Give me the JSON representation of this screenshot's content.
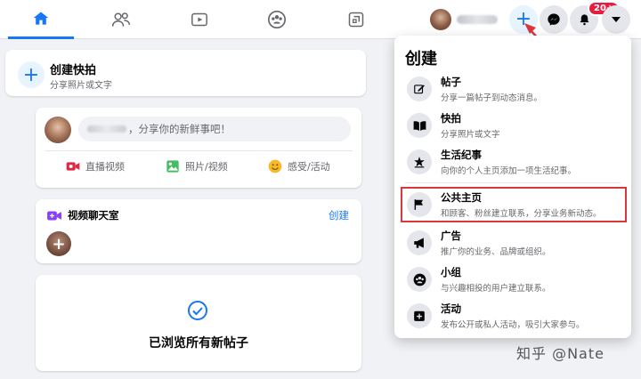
{
  "nav": {
    "tabs": [
      {
        "name": "home",
        "icon": "home-icon"
      },
      {
        "name": "friends",
        "icon": "friends-icon"
      },
      {
        "name": "watch",
        "icon": "watch-icon"
      },
      {
        "name": "groups",
        "icon": "groups-icon"
      },
      {
        "name": "gaming",
        "icon": "gaming-icon"
      }
    ],
    "create_symbol": "+",
    "notification_badge": "20+"
  },
  "story": {
    "plus": "+",
    "title": "创建快拍",
    "subtitle": "分享照片或文字"
  },
  "composer": {
    "placeholder": "，分享你的新鲜事吧！",
    "actions": [
      {
        "label": "直播视频",
        "color": "#e42645"
      },
      {
        "label": "照片/视频",
        "color": "#45bd62"
      },
      {
        "label": "感受/活动",
        "color": "#f7b928"
      }
    ]
  },
  "rooms": {
    "title": "视频聊天室",
    "create_link": "创建",
    "plus": "+"
  },
  "feed_end": {
    "text": "已浏览所有新帖子"
  },
  "create_menu": {
    "title": "创建",
    "items": [
      {
        "label": "帖子",
        "desc": "分享一篇帖子到动态消息。",
        "icon": "edit-icon"
      },
      {
        "label": "快拍",
        "desc": "分享照片或文字",
        "icon": "book-icon"
      },
      {
        "label": "生活纪事",
        "desc": "向你的个人主页添加一项生活纪事。",
        "icon": "star-icon"
      },
      {
        "label": "公共主页",
        "desc": "和顾客、粉丝建立联系，分享业务新动态。",
        "icon": "flag-icon"
      },
      {
        "label": "广告",
        "desc": "推广你的业务、品牌或组织。",
        "icon": "megaphone-icon"
      },
      {
        "label": "小组",
        "desc": "与兴趣相投的用户建立联系。",
        "icon": "group-icon"
      },
      {
        "label": "活动",
        "desc": "发布公开或私人活动，吸引大家参与。",
        "icon": "event-icon"
      }
    ]
  },
  "colors": {
    "accent": "#1877f2",
    "highlight": "#d9363e"
  },
  "watermark": "知乎 @Nate"
}
